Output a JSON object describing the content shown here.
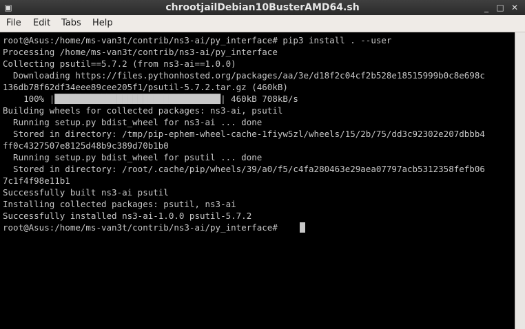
{
  "window": {
    "title": "chrootjailDebian10BusterAMD64.sh",
    "title_icon": "terminal-icon",
    "controls": {
      "minimize_glyph": "_",
      "maximize_glyph": "□",
      "close_glyph": "✕"
    }
  },
  "menu": {
    "items": [
      {
        "label": "File"
      },
      {
        "label": "Edit"
      },
      {
        "label": "Tabs"
      },
      {
        "label": "Help"
      }
    ]
  },
  "terminal": {
    "lines": [
      "root@Asus:/home/ms-van3t/contrib/ns3-ai/py_interface# pip3 install . --user",
      "Processing /home/ms-van3t/contrib/ns3-ai/py_interface",
      "Collecting psutil==5.7.2 (from ns3-ai==1.0.0)",
      "  Downloading https://files.pythonhosted.org/packages/aa/3e/d18f2c04cf2b528e18515999b0c8e698c",
      "136db78f62df34eee89cee205f1/psutil-5.7.2.tar.gz (460kB)",
      "    100% |████████████████████████████████| 460kB 708kB/s",
      "Building wheels for collected packages: ns3-ai, psutil",
      "  Running setup.py bdist_wheel for ns3-ai ... done",
      "  Stored in directory: /tmp/pip-ephem-wheel-cache-1fiyw5zl/wheels/15/2b/75/dd3c92302e207dbbb4",
      "ff0c4327507e8125d48b9c389d70b1b0",
      "  Running setup.py bdist_wheel for psutil ... done",
      "  Stored in directory: /root/.cache/pip/wheels/39/a0/f5/c4fa280463e29aea07797acb5312358fefb06",
      "7c1f4f98e11b1",
      "Successfully built ns3-ai psutil",
      "Installing collected packages: psutil, ns3-ai",
      "Successfully installed ns3-ai-1.0.0 psutil-5.7.2",
      "root@Asus:/home/ms-van3t/contrib/ns3-ai/py_interface# "
    ],
    "progress_fraction": 1.0,
    "colors": {
      "background": "#000000",
      "foreground": "#c8c8c8"
    }
  }
}
